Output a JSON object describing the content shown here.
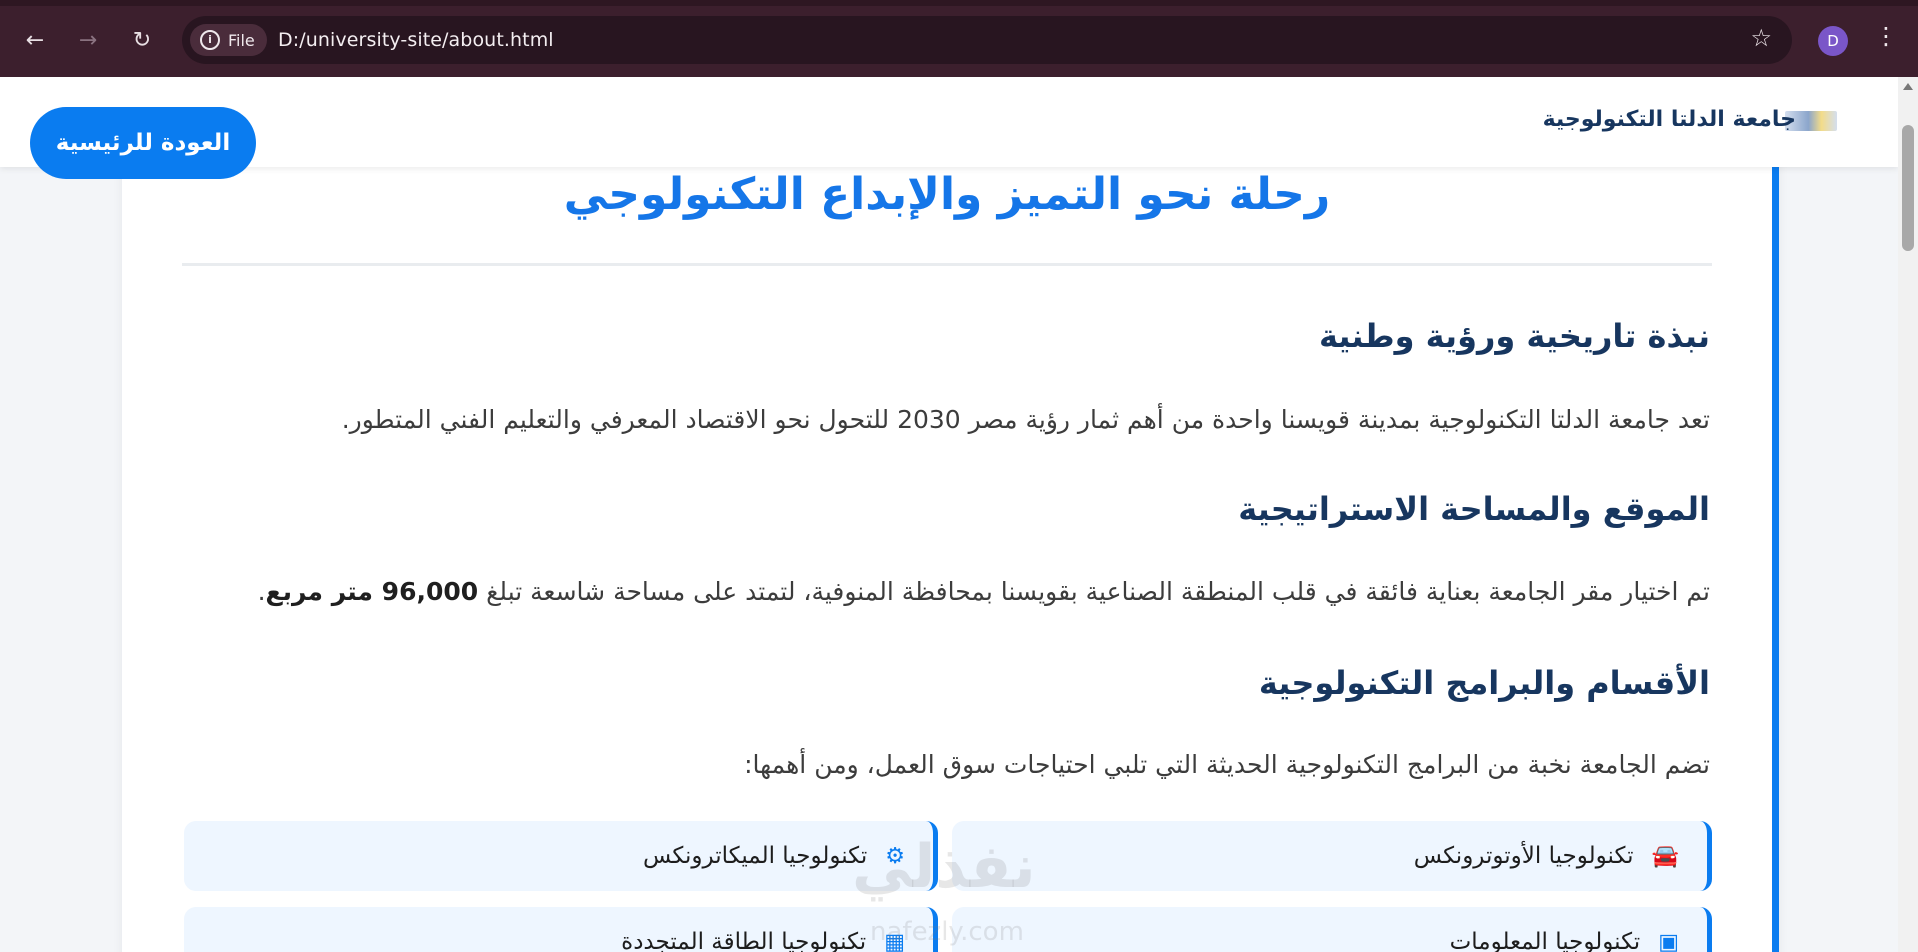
{
  "browser": {
    "back_icon": "arrow-left-icon",
    "forward_icon": "arrow-right-icon",
    "reload_icon": "reload-icon",
    "site_chip_label": "File",
    "url": "D:/university-site/about.html",
    "bookmark_icon": "star-icon",
    "profile_initial": "D",
    "menu_icon": "kebab-menu-icon"
  },
  "header": {
    "brand_name": "جامعة الدلتا التكنولوجية",
    "home_button": "العودة للرئيسية"
  },
  "main": {
    "title": "رحلة نحو التميز والإبداع التكنولوجي",
    "sections": [
      {
        "heading": "نبذة تاريخية ورؤية وطنية",
        "text": "تعد جامعة الدلتا التكنولوجية بمدينة قويسنا واحدة من أهم ثمار رؤية مصر 2030 للتحول نحو الاقتصاد المعرفي والتعليم الفني المتطور."
      },
      {
        "heading": "الموقع والمساحة الاستراتيجية",
        "text_before": "تم اختيار مقر الجامعة بعناية فائقة في قلب المنطقة الصناعية بقويسنا بمحافظة المنوفية، لتمتد على مساحة شاسعة تبلغ",
        "text_bold": "96,000 متر مربع",
        "text_after": "."
      },
      {
        "heading": "الأقسام والبرامج التكنولوجية",
        "text": "تضم الجامعة نخبة من البرامج التكنولوجية الحديثة التي تلبي احتياجات سوق العمل، ومن أهمها:"
      }
    ],
    "programs": [
      {
        "label": "تكنولوجيا الأوتوترونكس",
        "icon": "car-icon"
      },
      {
        "label": "تكنولوجيا الميكاترونكس",
        "icon": "robot-icon"
      },
      {
        "label": "تكنولوجيا المعلومات",
        "icon": "computer-icon"
      },
      {
        "label": "تكنولوجيا الطاقة المتجددة",
        "icon": "solar-panel-icon"
      }
    ]
  },
  "watermark": {
    "main": "نفذلي",
    "sub": "nafezly.com"
  },
  "colors": {
    "accent": "#0a7cf0",
    "heading": "#17365f",
    "chrome": "#3c1f2d"
  }
}
